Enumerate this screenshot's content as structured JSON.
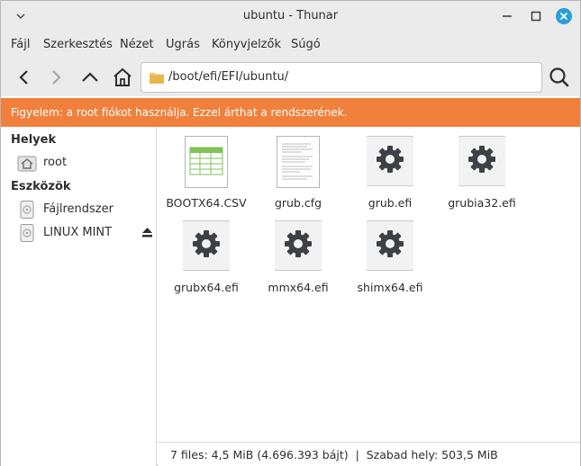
{
  "window": {
    "title": "ubuntu - Thunar"
  },
  "menubar": {
    "items": [
      "Fájl",
      "Szerkesztés",
      "Nézet",
      "Ugrás",
      "Könyvjelzők",
      "Súgó"
    ]
  },
  "toolbar": {
    "path": "/boot/efi/EFI/ubuntu/",
    "icons": [
      "back-icon",
      "forward-icon",
      "up-icon",
      "home-icon",
      "folder-icon",
      "search-icon"
    ]
  },
  "warning": {
    "text": "Figyelem: a root fiókot használja. Ezzel árthat a rendszerének."
  },
  "sidebar": {
    "places_heading": "Helyek",
    "places": [
      {
        "label": "root",
        "icon": "home-folder-icon"
      }
    ],
    "devices_heading": "Eszközök",
    "devices": [
      {
        "label": "Fájlrendszer",
        "icon": "drive-icon"
      },
      {
        "label": "LINUX MINT",
        "icon": "drive-icon",
        "ejectable": true
      }
    ]
  },
  "files": [
    {
      "name": "BOOTX64.CSV",
      "type": "spreadsheet"
    },
    {
      "name": "grub.cfg",
      "type": "text"
    },
    {
      "name": "grub.efi",
      "type": "executable"
    },
    {
      "name": "grubia32.efi",
      "type": "executable"
    },
    {
      "name": "grubx64.efi",
      "type": "executable"
    },
    {
      "name": "mmx64.efi",
      "type": "executable"
    },
    {
      "name": "shimx64.efi",
      "type": "executable"
    }
  ],
  "status": {
    "text": "7 files: 4,5 MiB (4.696.393 bájt)  |  Szabad hely: 503,5 MiB"
  },
  "colors": {
    "warning_bg": "#f0803c",
    "chrome_bg": "#ebebeb",
    "close_button": "#2a9fd6"
  }
}
